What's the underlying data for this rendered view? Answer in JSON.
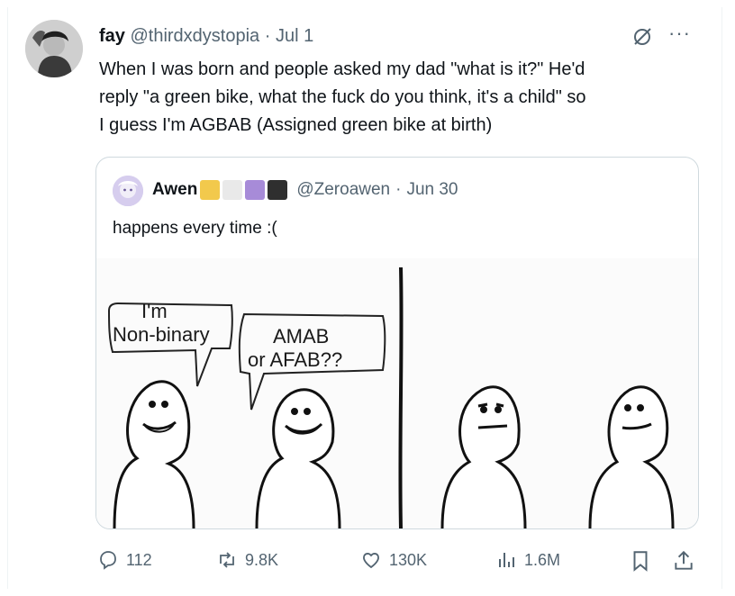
{
  "tweet": {
    "author_name": "fay",
    "author_handle": "@thirdxdystopia",
    "separator": "·",
    "date": "Jul 1",
    "more_label": "···",
    "text_lines": [
      "When I was born and people asked my dad \"what is it?\" He'd",
      "reply \"a green bike, what the fuck do you think, it's a child\" so",
      "I guess I'm AGBAB (Assigned green bike at birth)"
    ]
  },
  "quote": {
    "author_name": "Awen",
    "flag_colors": [
      "#f2c94c",
      "#e9e9e9",
      "#a78bd8",
      "#2f2f2f"
    ],
    "author_handle": "@Zeroawen",
    "separator": "·",
    "date": "Jun 30",
    "text": "happens every time :(",
    "comic": {
      "bubble1_line1": "I'm",
      "bubble1_line2": "Non-binary",
      "bubble2_line1": "AMAB",
      "bubble2_line2": "or AFAB??"
    }
  },
  "actions": {
    "replies": "112",
    "reposts": "9.8K",
    "likes": "130K",
    "views": "1.6M"
  },
  "colors": {
    "text": "#0f1419",
    "secondary": "#536471",
    "border": "#cfd9de"
  },
  "icons": [
    "grok-icon",
    "more-icon",
    "reply-icon",
    "repost-icon",
    "like-icon",
    "views-icon",
    "bookmark-icon",
    "share-icon"
  ]
}
